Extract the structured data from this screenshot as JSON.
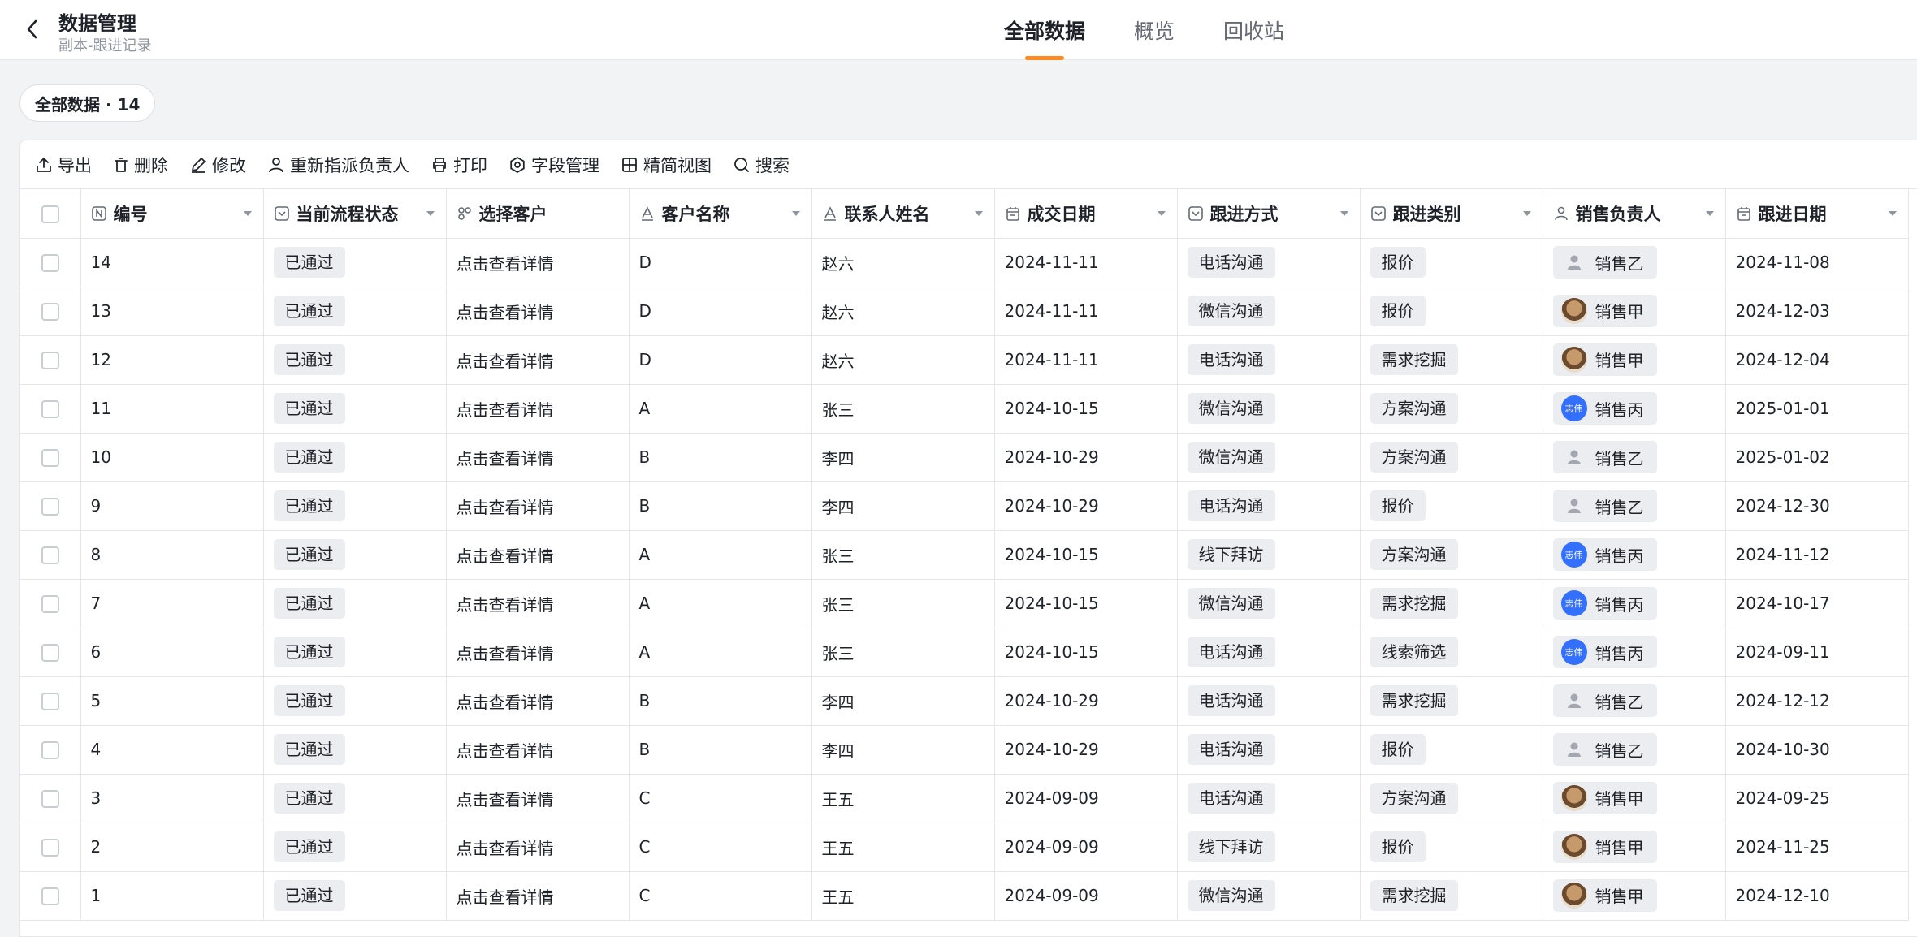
{
  "header": {
    "title": "数据管理",
    "subtitle": "副本-跟进记录",
    "tabs": [
      {
        "label": "全部数据",
        "active": true
      },
      {
        "label": "概览",
        "active": false
      },
      {
        "label": "回收站",
        "active": false
      }
    ]
  },
  "view_chip": "全部数据 · 14",
  "toolbar": {
    "export": "导出",
    "delete": "删除",
    "edit": "修改",
    "reassign": "重新指派负责人",
    "print": "打印",
    "fields": "字段管理",
    "simple_view": "精简视图",
    "search": "搜索"
  },
  "columns": {
    "id": "编号",
    "status": "当前流程状态",
    "select_customer": "选择客户",
    "customer_name": "客户名称",
    "contact": "联系人姓名",
    "deal_date": "成交日期",
    "method": "跟进方式",
    "category": "跟进类别",
    "sales": "销售负责人",
    "follow_date": "跟进日期"
  },
  "avatar_blue_text": "志伟",
  "rows": [
    {
      "id": "14",
      "status": "已通过",
      "select": "点击查看详情",
      "customer": "D",
      "contact": "赵六",
      "deal_date": "2024-11-11",
      "method": "电话沟通",
      "category": "报价",
      "sales": "销售乙",
      "follow_date": "2024-11-08"
    },
    {
      "id": "13",
      "status": "已通过",
      "select": "点击查看详情",
      "customer": "D",
      "contact": "赵六",
      "deal_date": "2024-11-11",
      "method": "微信沟通",
      "category": "报价",
      "sales": "销售甲",
      "follow_date": "2024-12-03"
    },
    {
      "id": "12",
      "status": "已通过",
      "select": "点击查看详情",
      "customer": "D",
      "contact": "赵六",
      "deal_date": "2024-11-11",
      "method": "电话沟通",
      "category": "需求挖掘",
      "sales": "销售甲",
      "follow_date": "2024-12-04"
    },
    {
      "id": "11",
      "status": "已通过",
      "select": "点击查看详情",
      "customer": "A",
      "contact": "张三",
      "deal_date": "2024-10-15",
      "method": "微信沟通",
      "category": "方案沟通",
      "sales": "销售丙",
      "follow_date": "2025-01-01"
    },
    {
      "id": "10",
      "status": "已通过",
      "select": "点击查看详情",
      "customer": "B",
      "contact": "李四",
      "deal_date": "2024-10-29",
      "method": "微信沟通",
      "category": "方案沟通",
      "sales": "销售乙",
      "follow_date": "2025-01-02"
    },
    {
      "id": "9",
      "status": "已通过",
      "select": "点击查看详情",
      "customer": "B",
      "contact": "李四",
      "deal_date": "2024-10-29",
      "method": "电话沟通",
      "category": "报价",
      "sales": "销售乙",
      "follow_date": "2024-12-30"
    },
    {
      "id": "8",
      "status": "已通过",
      "select": "点击查看详情",
      "customer": "A",
      "contact": "张三",
      "deal_date": "2024-10-15",
      "method": "线下拜访",
      "category": "方案沟通",
      "sales": "销售丙",
      "follow_date": "2024-11-12"
    },
    {
      "id": "7",
      "status": "已通过",
      "select": "点击查看详情",
      "customer": "A",
      "contact": "张三",
      "deal_date": "2024-10-15",
      "method": "微信沟通",
      "category": "需求挖掘",
      "sales": "销售丙",
      "follow_date": "2024-10-17"
    },
    {
      "id": "6",
      "status": "已通过",
      "select": "点击查看详情",
      "customer": "A",
      "contact": "张三",
      "deal_date": "2024-10-15",
      "method": "电话沟通",
      "category": "线索筛选",
      "sales": "销售丙",
      "follow_date": "2024-09-11"
    },
    {
      "id": "5",
      "status": "已通过",
      "select": "点击查看详情",
      "customer": "B",
      "contact": "李四",
      "deal_date": "2024-10-29",
      "method": "电话沟通",
      "category": "需求挖掘",
      "sales": "销售乙",
      "follow_date": "2024-12-12"
    },
    {
      "id": "4",
      "status": "已通过",
      "select": "点击查看详情",
      "customer": "B",
      "contact": "李四",
      "deal_date": "2024-10-29",
      "method": "电话沟通",
      "category": "报价",
      "sales": "销售乙",
      "follow_date": "2024-10-30"
    },
    {
      "id": "3",
      "status": "已通过",
      "select": "点击查看详情",
      "customer": "C",
      "contact": "王五",
      "deal_date": "2024-09-09",
      "method": "电话沟通",
      "category": "方案沟通",
      "sales": "销售甲",
      "follow_date": "2024-09-25"
    },
    {
      "id": "2",
      "status": "已通过",
      "select": "点击查看详情",
      "customer": "C",
      "contact": "王五",
      "deal_date": "2024-09-09",
      "method": "线下拜访",
      "category": "报价",
      "sales": "销售甲",
      "follow_date": "2024-11-25"
    },
    {
      "id": "1",
      "status": "已通过",
      "select": "点击查看详情",
      "customer": "C",
      "contact": "王五",
      "deal_date": "2024-09-09",
      "method": "微信沟通",
      "category": "需求挖掘",
      "sales": "销售甲",
      "follow_date": "2024-12-10"
    }
  ]
}
